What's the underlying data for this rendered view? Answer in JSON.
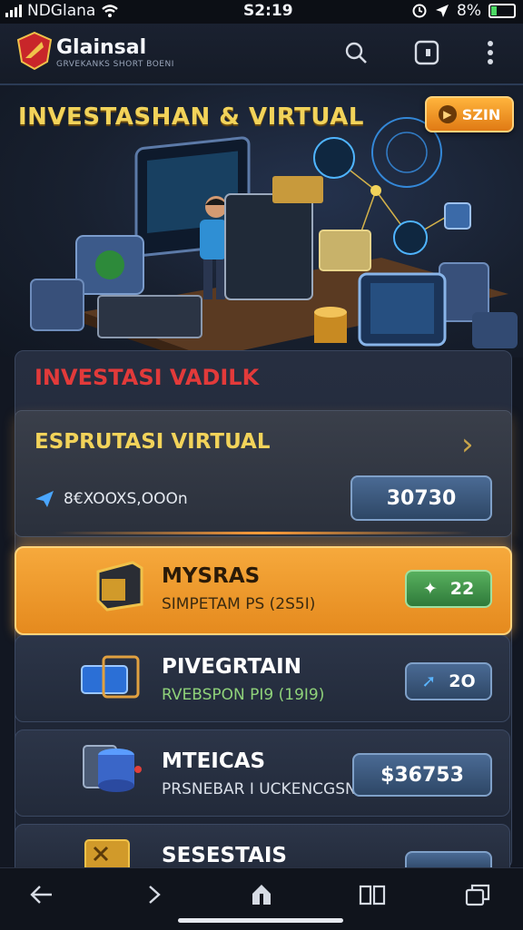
{
  "status_bar": {
    "carrier": "NDGlana",
    "time": "S2:19",
    "battery": "8%"
  },
  "header": {
    "app_name": "Glainsal",
    "app_subtitle": "GRVEKANKS SHORT BOENI",
    "icons": [
      "search-icon",
      "square-app-icon",
      "more-vertical-icon"
    ]
  },
  "hero": {
    "title": "INVESTASHAN & VIRTUAL",
    "spin_label": "SZIN"
  },
  "panel": {
    "title": "INVESTASI VADILK",
    "featured": {
      "title": "ESPRUTASI VIRTUAL",
      "subtitle": "8€XOOXS,OOOn",
      "value": "30730"
    }
  },
  "items": [
    {
      "title": "MYSRAS",
      "subtitle": "SIMPETAM PS (2S5I)",
      "value": "22"
    },
    {
      "title": "PIVEGRTAIN",
      "subtitle": "RVEBSPON PI9 (19I9)",
      "value": "2O"
    },
    {
      "title": "MTEICAS",
      "subtitle": "PRSNEBAR I UCKENCGSN",
      "value": "$36753"
    },
    {
      "title": "SESESTAIS",
      "subtitle": "",
      "value": ""
    }
  ],
  "bottom_nav": [
    "back-icon",
    "forward-icon",
    "share-icon",
    "book-icon",
    "tabs-icon"
  ],
  "colors": {
    "accent_gold": "#f2d35a",
    "accent_orange": "#e58a1e",
    "title_red": "#e23a3a",
    "pill_green": "#3f9a4a",
    "pill_blue": "#3a5a86"
  }
}
